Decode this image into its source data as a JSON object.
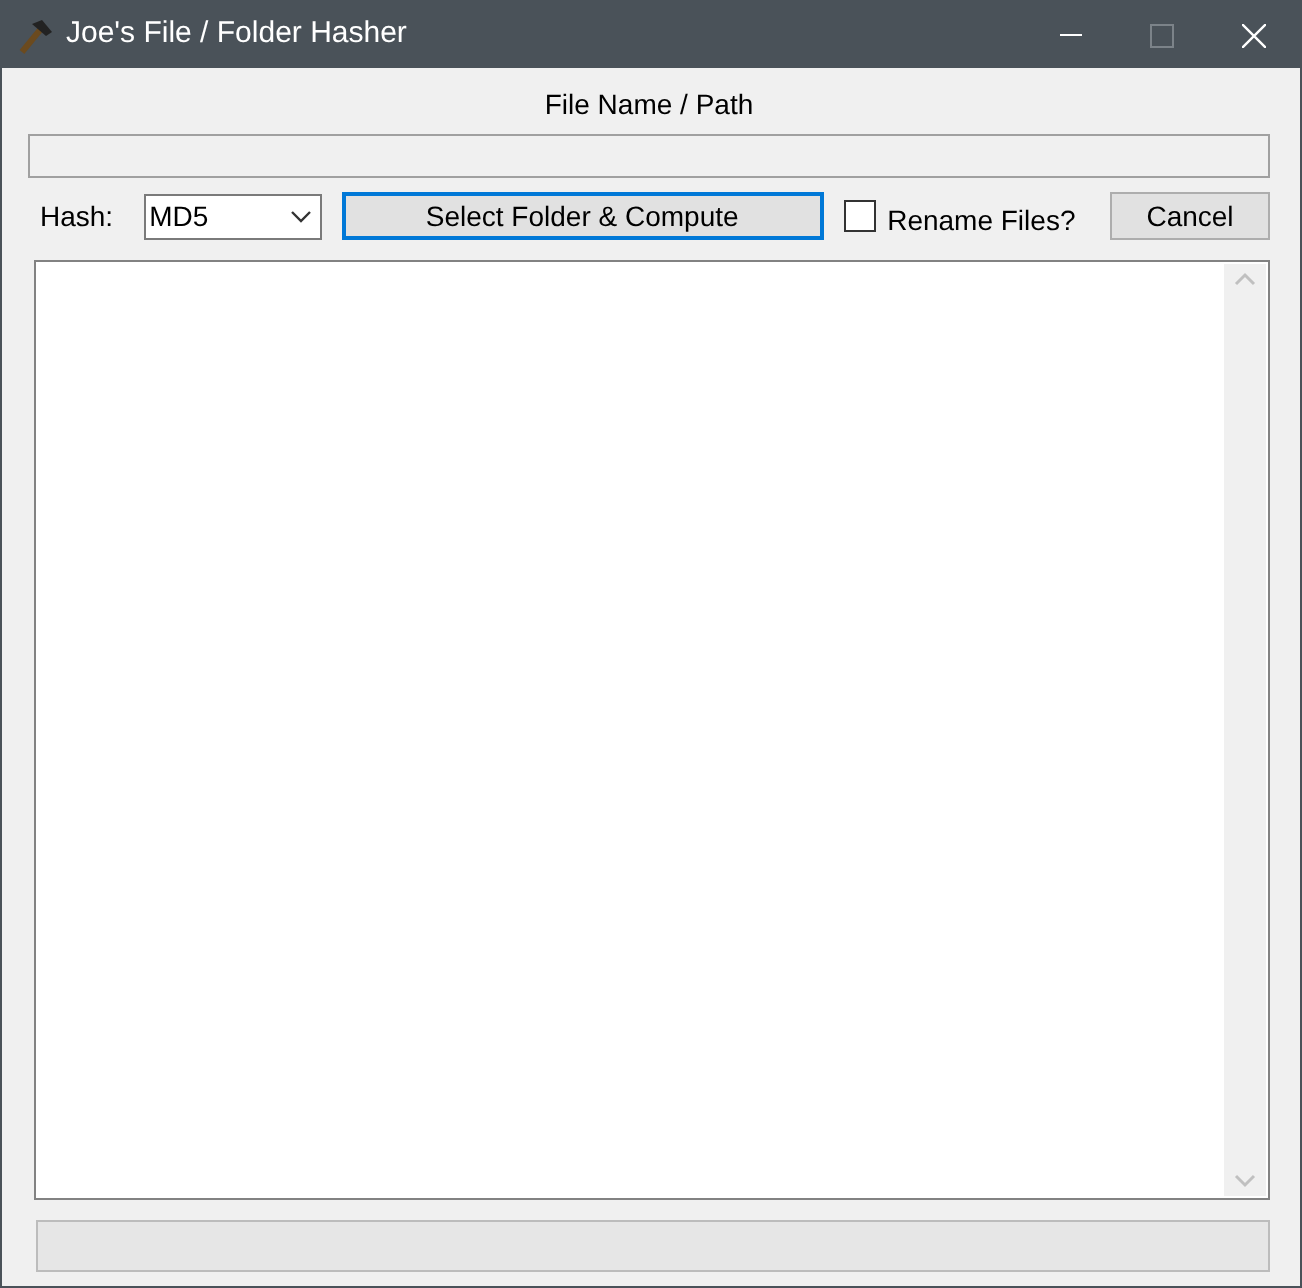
{
  "window": {
    "title": "Joe's File / Folder Hasher"
  },
  "path_label": "File Name / Path",
  "hash_label": "Hash:",
  "hash_select": {
    "value": "MD5"
  },
  "compute_button": {
    "label": "Select Folder & Compute",
    "focused": true
  },
  "rename_checkbox": {
    "label": "Rename Files?",
    "checked": false
  },
  "cancel_button": {
    "label": "Cancel"
  }
}
